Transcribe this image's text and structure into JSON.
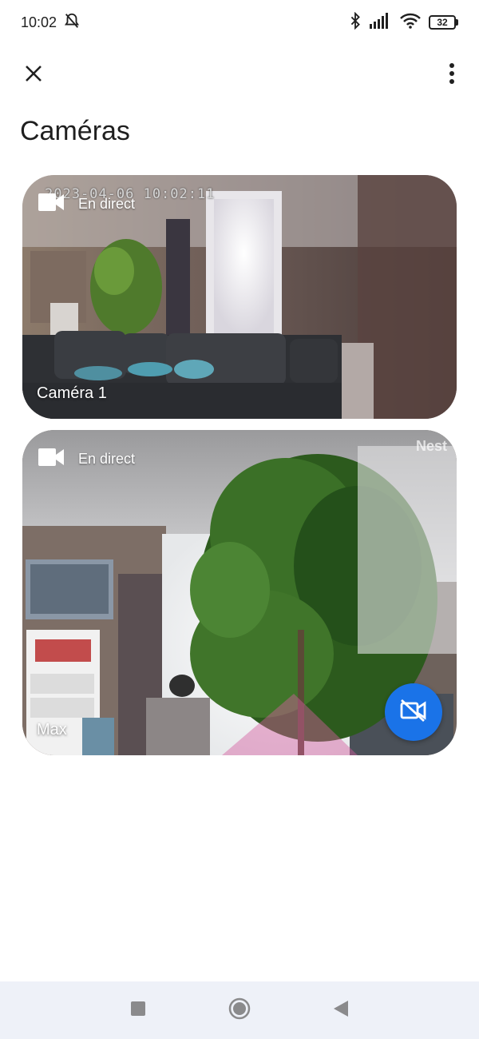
{
  "status_bar": {
    "time": "10:02",
    "battery": "32"
  },
  "header": {
    "title": "Caméras"
  },
  "cameras": [
    {
      "name": "Caméra 1",
      "live_label": "En direct",
      "timestamp": "2023-04-06 10:02:11"
    },
    {
      "name": "Max",
      "live_label": "En direct",
      "watermark": "Nest"
    }
  ],
  "colors": {
    "accent": "#1a73e8",
    "nav_bg": "#eef1f8"
  },
  "icons": {
    "close": "close-icon",
    "more": "more-vert-icon",
    "video_camera": "videocam-icon",
    "video_off": "videocam-off-icon",
    "nav_recents": "square-icon",
    "nav_home": "circle-icon",
    "nav_back": "triangle-back-icon"
  }
}
